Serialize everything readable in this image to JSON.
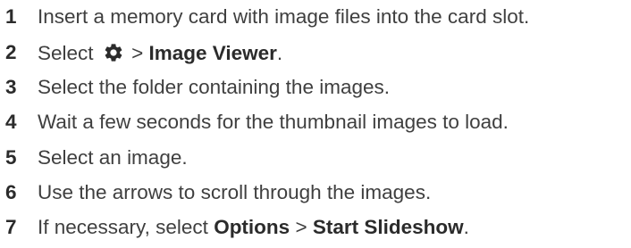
{
  "steps": [
    {
      "number": "1",
      "text": "Insert a memory card with image files into the card slot."
    },
    {
      "number": "2",
      "prefix": "Select",
      "icon": "gear-icon",
      "separator": ">",
      "target": "Image Viewer",
      "suffix": "."
    },
    {
      "number": "3",
      "text": "Select the folder containing the images."
    },
    {
      "number": "4",
      "text": "Wait a few seconds for the thumbnail images to load."
    },
    {
      "number": "5",
      "text": "Select an image."
    },
    {
      "number": "6",
      "text": "Use the arrows to scroll through the images."
    },
    {
      "number": "7",
      "prefix": "If necessary, select",
      "menu": "Options",
      "separator": ">",
      "target": "Start Slideshow",
      "suffix": "."
    }
  ]
}
